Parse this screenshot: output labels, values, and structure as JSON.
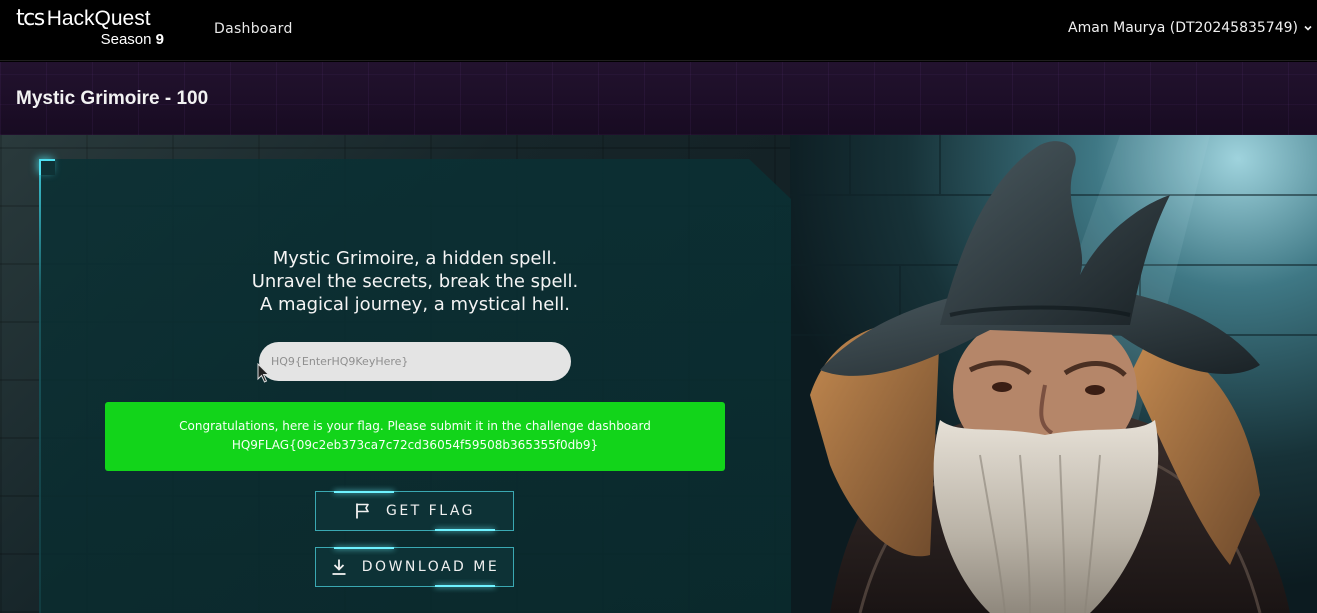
{
  "navbar": {
    "logo": {
      "brand": "tcs",
      "product": "HackQuest",
      "season_prefix": "Season",
      "season_number": "9"
    },
    "nav_dashboard": "Dashboard",
    "user_name": "Aman Maurya (DT20245835749)"
  },
  "page": {
    "title": "Mystic Grimoire - 100"
  },
  "challenge": {
    "poem": [
      "Mystic Grimoire, a hidden spell.",
      "Unravel the secrets, break the spell.",
      "A magical journey, a mystical hell."
    ],
    "flag_input": {
      "placeholder": "HQ9{EnterHQ9KeyHere}",
      "value": ""
    },
    "alert": {
      "message": "Congratulations, here is your flag. Please submit it in the challenge dashboard",
      "flag": "HQ9FLAG{09c2eb373ca7c72cd36054f59508b365355f0db9}",
      "color": "#12d41a"
    },
    "buttons": {
      "get_flag": {
        "label": "GET FLAG",
        "icon": "flag-icon"
      },
      "download": {
        "label": "DOWNLOAD ME",
        "icon": "download-icon"
      }
    }
  },
  "colors": {
    "navbar_bg": "#000000",
    "title_band_bg": "#1d0f28",
    "panel_bg": "#0a3034",
    "accent_cyan": "#6ef2ff"
  }
}
